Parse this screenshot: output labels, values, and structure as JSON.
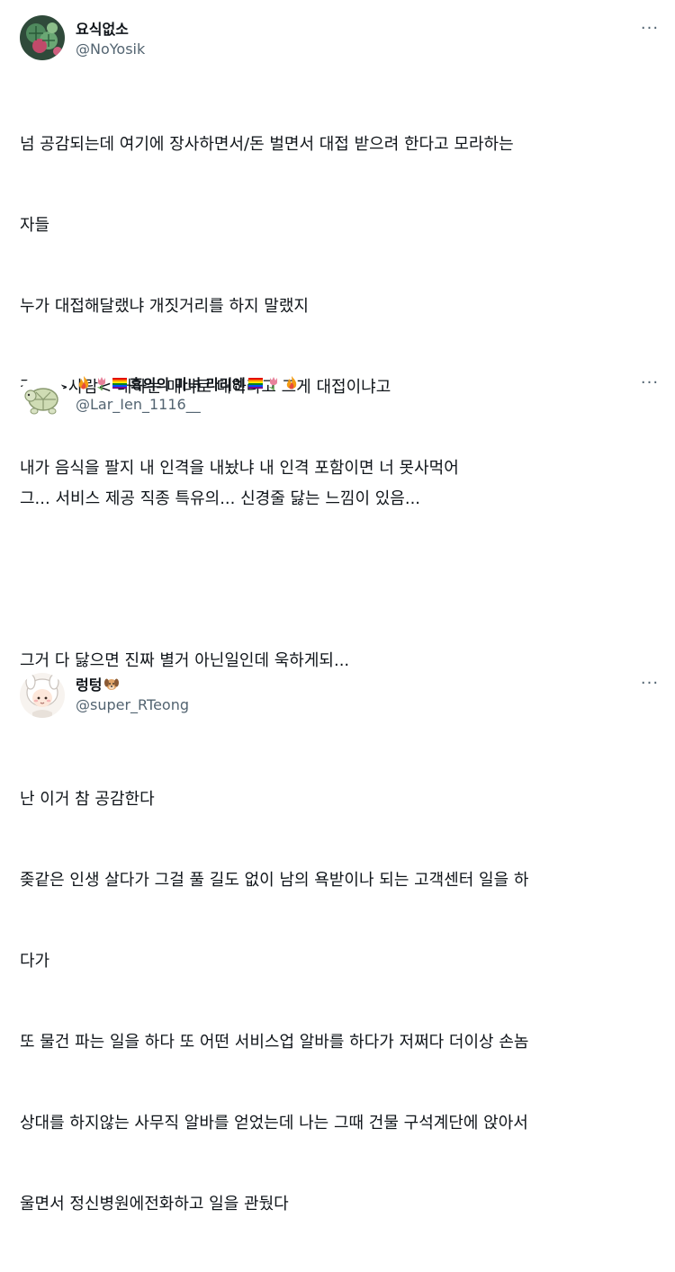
{
  "tweets": [
    {
      "display_name": "요식없소",
      "handle": "@NoYosik",
      "more_label": "···",
      "avatar_icon": "cactus-avatar",
      "lines": [
        "넘 공감되는데 여기에 장사하면서/돈 벌면서 대접 받으려 한다고 모라하는",
        "자들",
        "누가 대접해달랬냐 개짓거리를 하지 말랬지",
        "같은 >사람< 대하는 매너로 대하라고 그게 대접이냐고",
        "내가 음식을 팔지 내 인격을 내놨냐 내 인격 포함이면 너 못사먹어"
      ]
    },
    {
      "display_name": "흑의의 마녀 라리엔",
      "name_prefix_emoji": [
        "fire-emoji",
        "tulip-emoji",
        "rainbow-flag-emoji"
      ],
      "name_suffix_emoji": [
        "rainbow-flag-emoji",
        "tulip-emoji",
        "fire-emoji"
      ],
      "handle": "@Lar_Ien_1116__",
      "more_label": "···",
      "avatar_icon": "turtle-avatar",
      "lines": [
        "그... 서비스 제공 직종 특유의... 신경줄 닳는 느낌이 있음...",
        "",
        "그거 다 닳으면 진짜 별거 아닌일인데 욱하게되..."
      ]
    },
    {
      "display_name": "렁텅",
      "name_suffix_emoji": [
        "dog-face-emoji"
      ],
      "handle": "@super_RTeong",
      "more_label": "···",
      "avatar_icon": "chibi-character-avatar",
      "lines": [
        "난 이거 참 공감한다",
        "좆같은 인생 살다가 그걸 풀 길도 없이 남의 욕받이나 되는 고객센터 일을 하",
        "다가",
        "또 물건 파는 일을 하다 또 어떤 서비스업 알바를 하다가 저쩌다 더이상 손놈",
        "상대를 하지않는 사무직 알바를 얻었는데 나는 그때 건물 구석계단에 앉아서",
        "울면서 정신병원에전화하고 일을 관뒀다"
      ]
    }
  ],
  "colors": {
    "text": "#0f1419",
    "secondary": "#536471",
    "background": "#ffffff"
  }
}
